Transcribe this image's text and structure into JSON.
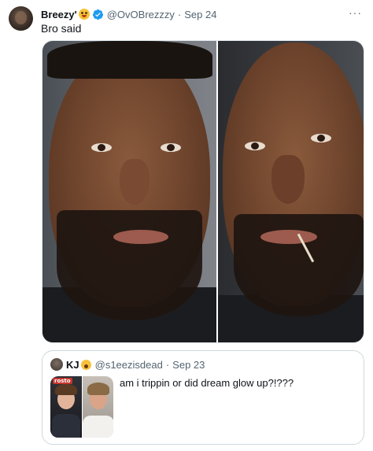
{
  "post": {
    "author_name": "Breezy'",
    "author_emoji": "smiling-face-with-heart-eyes-emoji",
    "verified": true,
    "handle": "@OvOBrezzzy",
    "separator": "·",
    "date": "Sep 24",
    "text": "Bro said",
    "more_label": "···"
  },
  "quoted_post": {
    "author_name": "KJ",
    "author_emoji": "worried-face-emoji",
    "handle": "@s1eezisdead",
    "separator": "·",
    "date": "Sep 23",
    "text": "am i trippin or did dream glow up?!???",
    "thumbnail_label": "rosto"
  },
  "colors": {
    "verified_blue": "#1d9bf0",
    "secondary_text": "#536471",
    "border": "#cfd9de"
  }
}
